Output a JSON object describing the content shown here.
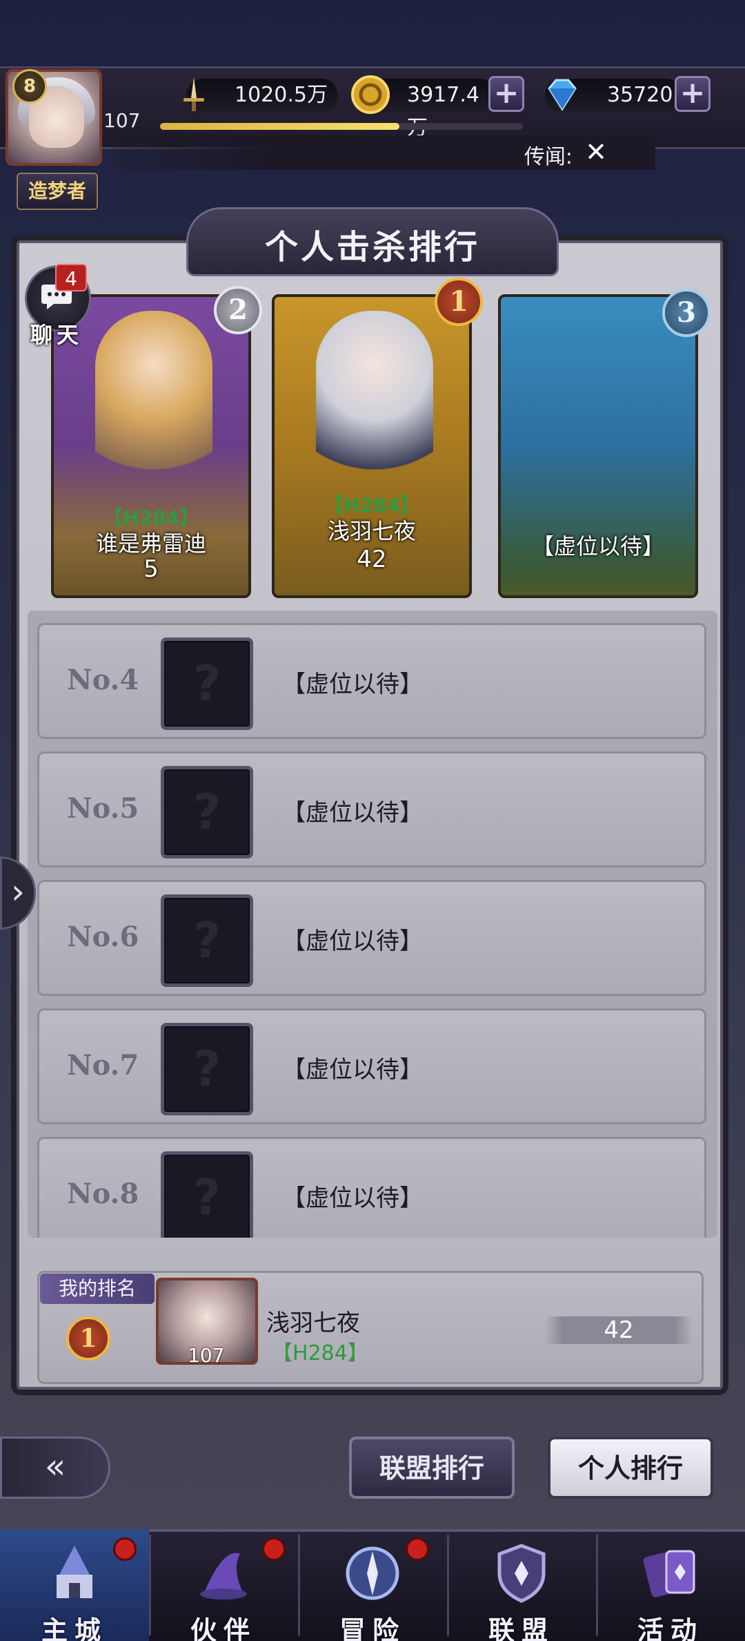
{
  "hud": {
    "player_level": "8",
    "player_avatar_level": "107",
    "title_badge": "造梦者",
    "combat_power": "1020.5万",
    "gold": "3917.4万",
    "diamonds": "35720",
    "exp_progress": 0.66,
    "rumor_label": "传闻:",
    "icons": {
      "power": "sword-icon",
      "gold": "gold-coin-icon",
      "diamond": "diamond-icon",
      "plus": "plus-icon",
      "rumor_close": "crossed-swords-icon"
    }
  },
  "panel": {
    "title": "个人击杀排行"
  },
  "chat": {
    "badge_count": "4",
    "label": "聊天"
  },
  "top_three": [
    {
      "rank": "2",
      "server": "【H284】",
      "name": "谁是弗雷迪",
      "score": "5"
    },
    {
      "rank": "1",
      "server": "【H284】",
      "name": "浅羽七夜",
      "score": "42"
    },
    {
      "rank": "3",
      "name": "【虚位以待】"
    }
  ],
  "ranking_list": [
    {
      "no": "No.4",
      "name": "【虚位以待】"
    },
    {
      "no": "No.5",
      "name": "【虚位以待】"
    },
    {
      "no": "No.6",
      "name": "【虚位以待】"
    },
    {
      "no": "No.7",
      "name": "【虚位以待】"
    },
    {
      "no": "No.8",
      "name": "【虚位以待】"
    }
  ],
  "my_rank": {
    "label": "我的排名",
    "rank": "1",
    "avatar_level": "107",
    "name": "浅羽七夜",
    "server": "【H284】",
    "score": "42"
  },
  "tabs": {
    "alliance": "联盟排行",
    "personal": "个人排行"
  },
  "bottom_nav": [
    {
      "label": "主城",
      "icon": "castle-icon",
      "active": true,
      "dot": true
    },
    {
      "label": "伙伴",
      "icon": "wizard-hat-icon",
      "active": false,
      "dot": true
    },
    {
      "label": "冒险",
      "icon": "compass-icon",
      "active": false,
      "dot": true
    },
    {
      "label": "联盟",
      "icon": "shield-icon",
      "active": false,
      "dot": false
    },
    {
      "label": "活动",
      "icon": "cards-icon",
      "active": false,
      "dot": false
    }
  ],
  "colors": {
    "server_green": "#2f9a3e",
    "medal_gold": "#f0b840",
    "panel_bg": "#cbc9d1"
  }
}
